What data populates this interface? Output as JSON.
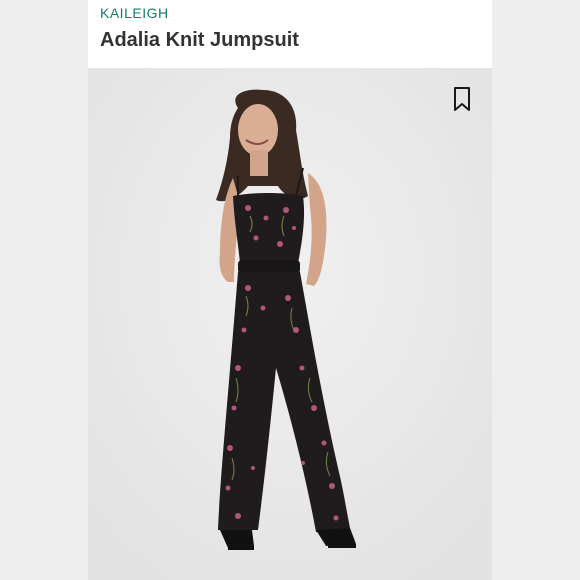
{
  "product": {
    "brand": "KAILEIGH",
    "title": "Adalia Knit Jumpsuit"
  },
  "colors": {
    "brand": "#177a6b",
    "title": "#333333",
    "photo_bg": "#e9e9e9",
    "jumpsuit": "#201c1e",
    "floral": "#b0577a"
  },
  "icons": {
    "save": "bookmark-icon"
  }
}
